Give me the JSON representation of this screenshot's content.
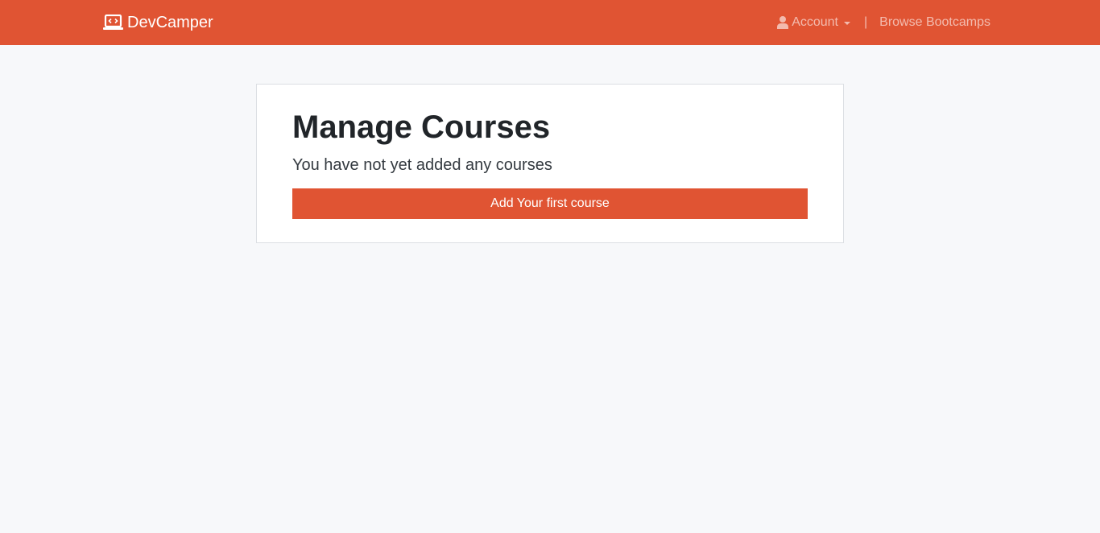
{
  "navbar": {
    "brand_label": "DevCamper",
    "brand_icon": "laptop-code-icon",
    "account_label": "Account",
    "account_icon": "user-icon",
    "separator": "|",
    "browse_label": "Browse Bootcamps"
  },
  "main": {
    "title": "Manage Courses",
    "message": "You have not yet added any courses",
    "add_button_label": "Add Your first course"
  },
  "colors": {
    "brand": "#e05433",
    "page_background": "#f7f8fa",
    "card_background": "#ffffff"
  }
}
